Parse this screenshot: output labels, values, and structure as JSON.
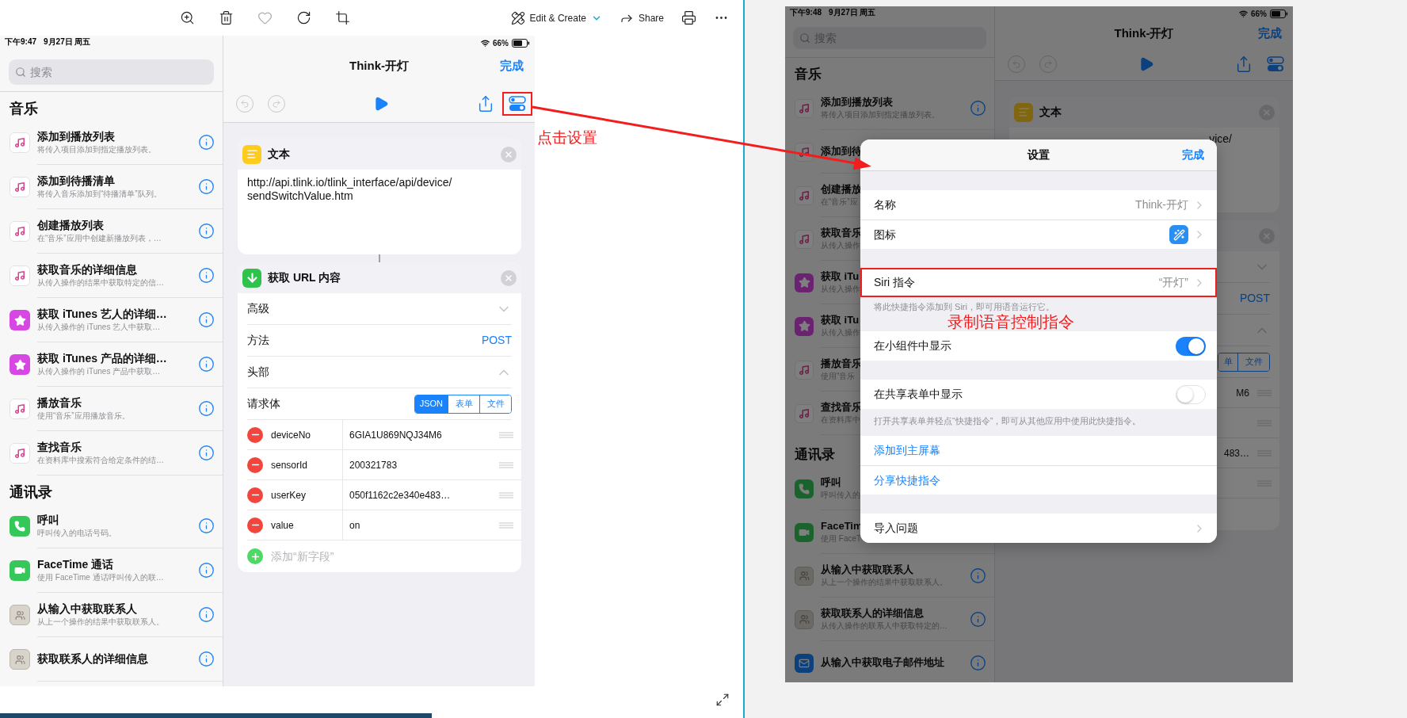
{
  "viewer": {
    "edit_label": "Edit & Create",
    "share_label": "Share"
  },
  "annotations": {
    "note": "点击设置"
  },
  "left_screen": {
    "status": {
      "time": "下午9:47",
      "date": "9月27日 周五",
      "battery": "66%"
    },
    "search_placeholder": "搜索",
    "sections": [
      {
        "title": "音乐",
        "items": [
          {
            "kind": "music",
            "title": "添加到播放列表",
            "subtitle": "将传入项目添加到指定播放列表。",
            "info": true
          },
          {
            "kind": "music",
            "title": "添加到待播清单",
            "subtitle": "将传入音乐添加到“待播清单”队列。",
            "info": true
          },
          {
            "kind": "music",
            "title": "创建播放列表",
            "subtitle": "在“音乐”应用中创建新播放列表，…",
            "info": true
          },
          {
            "kind": "music",
            "title": "获取音乐的详细信息",
            "subtitle": "从传入操作的结果中获取特定的信…",
            "info": true
          },
          {
            "kind": "star",
            "title": "获取 iTunes 艺人的详细…",
            "subtitle": "从传入操作的 iTunes 艺人中获取…",
            "info": true
          },
          {
            "kind": "star",
            "title": "获取 iTunes 产品的详细…",
            "subtitle": "从传入操作的 iTunes 产品中获取…",
            "info": true
          },
          {
            "kind": "music",
            "title": "播放音乐",
            "subtitle": "使用“音乐”应用播放音乐。",
            "info": true
          },
          {
            "kind": "music",
            "title": "查找音乐",
            "subtitle": "在资料库中搜索符合给定条件的结…",
            "info": true
          }
        ]
      },
      {
        "title": "通讯录",
        "items": [
          {
            "kind": "phone",
            "title": "呼叫",
            "subtitle": "呼叫传入的电话号码。",
            "info": true
          },
          {
            "kind": "facetime",
            "title": "FaceTime 通话",
            "subtitle": "使用 FaceTime 通话呼叫传入的联…",
            "info": true
          },
          {
            "kind": "contacts",
            "title": "从输入中获取联系人",
            "subtitle": "从上一个操作的结果中获取联系人。",
            "info": true
          },
          {
            "kind": "contacts",
            "title": "获取联系人的详细信息",
            "info": true
          }
        ]
      }
    ],
    "editor": {
      "title": "Think-开灯",
      "done": "完成",
      "settings_highlighted": true,
      "text_card": {
        "title": "文本",
        "body_lines": [
          "http://api.tlink.io/tlink_interface/api/device/",
          "sendSwitchValue.htm"
        ]
      },
      "url_card": {
        "title": "获取 URL 内容",
        "rows": [
          {
            "kind": "disclosure",
            "label": "高级",
            "expanded": false
          },
          {
            "kind": "value",
            "label": "方法",
            "value": "POST"
          },
          {
            "kind": "disclosure",
            "label": "头部",
            "expanded": true
          },
          {
            "kind": "segments",
            "label": "请求体",
            "segments": [
              {
                "label": "JSON",
                "selected": true
              },
              {
                "label": "表单",
                "selected": false
              },
              {
                "label": "文件",
                "selected": false
              }
            ]
          }
        ],
        "fields": [
          {
            "kind": "pair",
            "key": "deviceNo",
            "value": "6GIA1U869NQJ34M6"
          },
          {
            "kind": "pair",
            "key": "sensorId",
            "value": "200321783"
          },
          {
            "kind": "pair",
            "key": "userKey",
            "value": "050f1162c2e340e483…"
          },
          {
            "kind": "pair",
            "key": "value",
            "value": "on"
          }
        ],
        "add_label": "添加“新字段”"
      }
    }
  },
  "right_screen": {
    "status": {
      "time": "下午9:48",
      "date": "9月27日 周五",
      "battery": "66%"
    },
    "search_placeholder": "搜索",
    "sections": [
      {
        "title": "音乐",
        "items": [
          {
            "kind": "music",
            "title": "添加到播放列表",
            "subtitle": "将传入项目添加到指定播放列表。",
            "info": true
          },
          {
            "kind": "music",
            "title": "添加到待",
            "info": false
          },
          {
            "kind": "music",
            "title": "创建播放",
            "subtitle": "在“音乐”应",
            "info": false
          },
          {
            "kind": "music",
            "title": "获取音乐",
            "subtitle": "从传入操作",
            "info": false
          },
          {
            "kind": "star",
            "title": "获取 iTu",
            "subtitle": "从传入操作",
            "info": false
          },
          {
            "kind": "star",
            "title": "获取 iTu",
            "subtitle": "从传入操作",
            "info": false
          },
          {
            "kind": "music",
            "title": "播放音乐",
            "subtitle": "使用“音乐",
            "info": false
          },
          {
            "kind": "music",
            "title": "查找音乐",
            "subtitle": "在资料库中",
            "info": false
          }
        ]
      },
      {
        "title": "通讯录",
        "items": [
          {
            "kind": "phone",
            "title": "呼叫",
            "subtitle": "呼叫传入的",
            "info": false
          },
          {
            "kind": "facetime",
            "title": "FaceTim",
            "subtitle": "使用 FaceT",
            "info": false
          },
          {
            "kind": "contacts",
            "title": "从输入中获取联系人",
            "subtitle": "从上一个操作的结果中获取联系人。",
            "info": true
          },
          {
            "kind": "contacts",
            "title": "获取联系人的详细信息",
            "subtitle": "从传入操作的联系人中获取特定的…",
            "info": true
          },
          {
            "kind": "mail",
            "title": "从输入中获取电子邮件地址",
            "info": true
          }
        ]
      }
    ],
    "editor": {
      "title": "Think-开灯",
      "done": "完成",
      "settings_highlighted": false,
      "text_card": {
        "title": "文本",
        "body_tail": "vice/"
      },
      "url_card": {
        "rows": [
          {
            "kind": "disclosure",
            "expanded": false
          },
          {
            "kind": "value",
            "value": "POST"
          },
          {
            "kind": "disclosure",
            "expanded": true
          },
          {
            "kind": "segments",
            "segments": [
              {
                "label": "单",
                "selected": false
              },
              {
                "label": "文件",
                "selected": false
              }
            ]
          }
        ],
        "fields": [
          {
            "kind": "value",
            "value": "M6"
          },
          {
            "kind": "blank"
          },
          {
            "kind": "value",
            "value": "483…"
          },
          {
            "kind": "blank"
          }
        ]
      }
    },
    "modal": {
      "title": "设置",
      "done": "完成",
      "groups": [
        {
          "rows": [
            {
              "kind": "value",
              "label": "名称",
              "value": "Think-开灯",
              "annotated": false
            },
            {
              "kind": "icon",
              "label": "图标",
              "annotated": false
            }
          ]
        },
        {
          "rows": [
            {
              "kind": "value",
              "label": "Siri 指令",
              "value": "“开灯”",
              "annotated": true
            }
          ],
          "footer": "将此快捷指令添加到 Siri，即可用语音运行它。",
          "note": "录制语音控制指令"
        },
        {
          "rows": [
            {
              "kind": "toggle",
              "label": "在小组件中显示",
              "on": true,
              "annotated": false
            }
          ]
        },
        {
          "rows": [
            {
              "kind": "toggle",
              "label": "在共享表单中显示",
              "on": false,
              "annotated": false
            }
          ],
          "footer": "打开共享表单并轻点“快捷指令”，即可从其他应用中使用此快捷指令。"
        },
        {
          "rows": [
            {
              "kind": "link",
              "label": "添加到主屏幕",
              "annotated": false
            },
            {
              "kind": "link",
              "label": "分享快捷指令",
              "annotated": false
            }
          ]
        },
        {
          "rows": [
            {
              "kind": "value",
              "label": "导入问题",
              "annotated": false
            }
          ]
        }
      ]
    }
  }
}
